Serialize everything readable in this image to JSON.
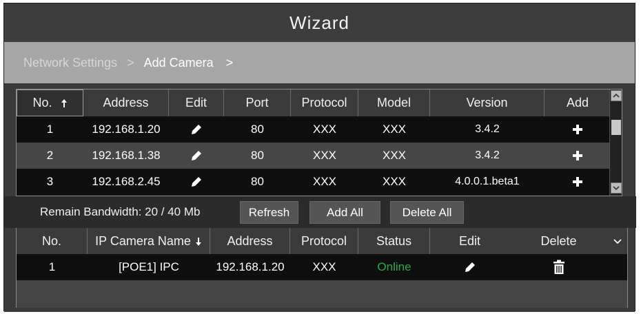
{
  "window": {
    "title": "Wizard"
  },
  "breadcrumb": {
    "step1": "Network Settings",
    "sep1": ">",
    "step2": "Add Camera",
    "sep2": ">"
  },
  "search_table": {
    "headers": {
      "no": "No.",
      "address": "Address",
      "edit": "Edit",
      "port": "Port",
      "protocol": "Protocol",
      "model": "Model",
      "version": "Version",
      "add": "Add"
    },
    "sort_icon": "arrow-up-icon",
    "rows": [
      {
        "no": "1",
        "address": "192.168.1.20",
        "port": "80",
        "protocol": "XXX",
        "model": "XXX",
        "version": "3.4.2"
      },
      {
        "no": "2",
        "address": "192.168.1.38",
        "port": "80",
        "protocol": "XXX",
        "model": "XXX",
        "version": "3.4.2"
      },
      {
        "no": "3",
        "address": "192.168.2.45",
        "port": "80",
        "protocol": "XXX",
        "model": "XXX",
        "version": "4.0.0.1.beta1"
      }
    ]
  },
  "controls": {
    "bandwidth": "Remain Bandwidth: 20 / 40 Mb",
    "refresh": "Refresh",
    "add_all": "Add All",
    "delete_all": "Delete All"
  },
  "added_table": {
    "headers": {
      "no": "No.",
      "name": "IP Camera Name",
      "address": "Address",
      "protocol": "Protocol",
      "status": "Status",
      "edit": "Edit",
      "delete": "Delete"
    },
    "sort_icon": "arrow-down-icon",
    "rows": [
      {
        "no": "1",
        "name": "[POE1] IPC",
        "address": "192.168.1.20",
        "protocol": "XXX",
        "status": "Online"
      }
    ]
  },
  "colors": {
    "online": "#2fa84a",
    "breadcrumb_bar": "#a6a6a6",
    "background": "#3a3a3a"
  }
}
